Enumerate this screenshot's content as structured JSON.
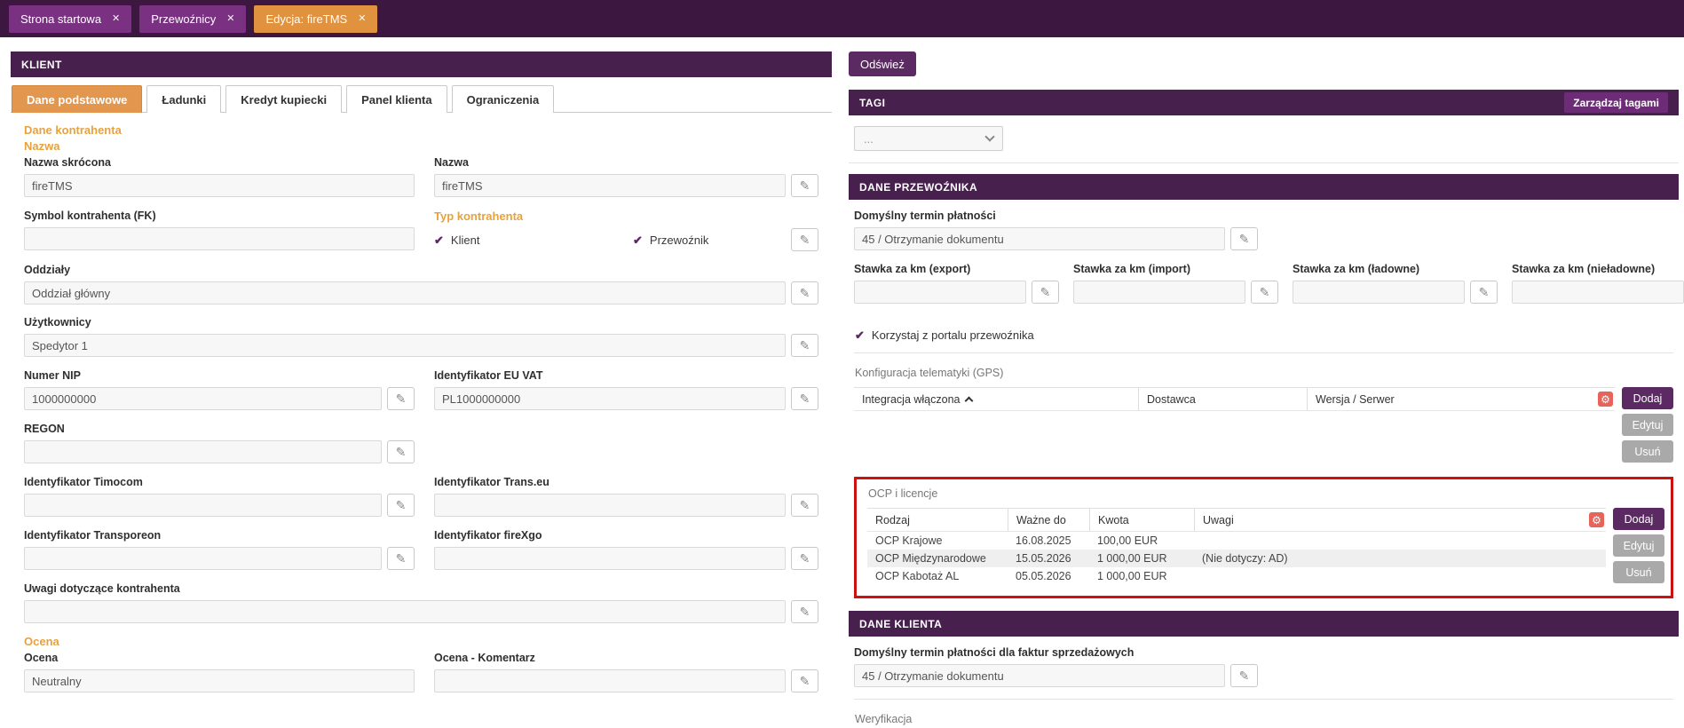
{
  "colors": {
    "brand_purple": "#47204d",
    "button_purple": "#5c2a63",
    "accent_orange": "#e0923e",
    "annotation_red": "#cc1111"
  },
  "window_tabs": [
    {
      "label": "Strona startowa"
    },
    {
      "label": "Przewoźnicy"
    },
    {
      "label": "Edycja: fireTMS"
    }
  ],
  "client_panel": {
    "header": "KLIENT",
    "tabs": [
      "Dane podstawowe",
      "Ładunki",
      "Kredyt kupiecki",
      "Panel klienta",
      "Ograniczenia"
    ],
    "section_kontrahent": "Dane kontrahenta",
    "section_nazwa": "Nazwa",
    "section_ocena": "Ocena",
    "fields": {
      "nazwa_skrocona": {
        "label": "Nazwa skrócona",
        "value": "fireTMS"
      },
      "nazwa": {
        "label": "Nazwa",
        "value": "fireTMS"
      },
      "symbol": {
        "label": "Symbol kontrahenta (FK)",
        "value": ""
      },
      "typ_kontrahenta": {
        "label": "Typ kontrahenta",
        "options": [
          {
            "label": "Klient",
            "checked": true
          },
          {
            "label": "Przewoźnik",
            "checked": true
          }
        ]
      },
      "oddzialy": {
        "label": "Oddziały",
        "value": "Oddział główny"
      },
      "uzytkownicy": {
        "label": "Użytkownicy",
        "value": "Spedytor 1"
      },
      "nip": {
        "label": "Numer NIP",
        "value": "1000000000"
      },
      "eu_vat": {
        "label": "Identyfikator EU VAT",
        "value": "PL1000000000"
      },
      "regon": {
        "label": "REGON",
        "value": ""
      },
      "timocom": {
        "label": "Identyfikator Timocom",
        "value": ""
      },
      "transeu": {
        "label": "Identyfikator Trans.eu",
        "value": ""
      },
      "transporeon": {
        "label": "Identyfikator Transporeon",
        "value": ""
      },
      "firexgo": {
        "label": "Identyfikator fireXgo",
        "value": ""
      },
      "uwagi": {
        "label": "Uwagi dotyczące kontrahenta",
        "value": ""
      },
      "ocena": {
        "label": "Ocena",
        "value": "Neutralny"
      },
      "ocena_komentarz": {
        "label": "Ocena - Komentarz",
        "value": ""
      }
    }
  },
  "right_panel": {
    "refresh_button": "Odśwież",
    "tags": {
      "header": "TAGI",
      "manage_button": "Zarządzaj tagami",
      "dropdown_value": "..."
    },
    "table_buttons": {
      "add": "Dodaj",
      "edit": "Edytuj",
      "delete": "Usuń"
    },
    "carrier": {
      "header": "DANE PRZEWOŹNIKA",
      "payment_term": {
        "label": "Domyślny termin płatności",
        "value": "45 / Otrzymanie dokumentu"
      },
      "rates": [
        {
          "label": "Stawka za km (export)",
          "value": ""
        },
        {
          "label": "Stawka za km (import)",
          "value": ""
        },
        {
          "label": "Stawka za km (ładowne)",
          "value": ""
        },
        {
          "label": "Stawka za km (nieładowne)",
          "value": ""
        }
      ],
      "portal_checkbox": "Korzystaj z portalu przewoźnika",
      "gps": {
        "title": "Konfiguracja telematyki (GPS)",
        "columns": [
          "Integracja włączona",
          "Dostawca",
          "Wersja / Serwer"
        ]
      },
      "ocp": {
        "title": "OCP i licencje",
        "columns": [
          "Rodzaj",
          "Ważne do",
          "Kwota",
          "Uwagi"
        ],
        "rows": [
          [
            "OCP Krajowe",
            "16.08.2025",
            "100,00 EUR",
            ""
          ],
          [
            "OCP Międzynarodowe",
            "15.05.2026",
            "1 000,00 EUR",
            "(Nie dotyczy: AD)"
          ],
          [
            "OCP Kabotaż AL",
            "05.05.2026",
            "1 000,00 EUR",
            ""
          ]
        ]
      }
    },
    "client": {
      "header": "DANE KLIENTA",
      "payment_term": {
        "label": "Domyślny termin płatności dla faktur sprzedażowych",
        "value": "45 / Otrzymanie dokumentu"
      },
      "verification_label": "Weryfikacja"
    }
  }
}
